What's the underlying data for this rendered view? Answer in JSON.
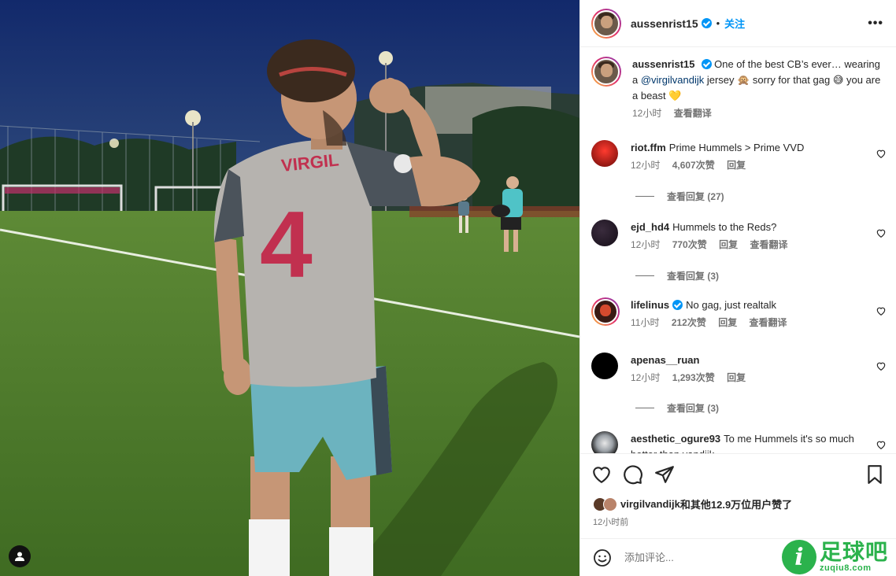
{
  "post": {
    "username": "aussenrist15",
    "follow_label": "关注",
    "dot": "•",
    "more_label": "•••"
  },
  "caption": {
    "username": "aussenrist15",
    "text_part1": "One of the best CB’s ever… wearing a ",
    "mention": "@virgilvandijk",
    "text_part2": " jersey 🙊 sorry for that gag 😅 you are a beast 💛",
    "time": "12小时",
    "translate_label": "查看翻译"
  },
  "comments": [
    {
      "username": "riot.ffm",
      "text": "Prime Hummels > Prime VVD",
      "time": "12小时",
      "likes": "4,607次赞",
      "reply_label": "回复",
      "replies_label": "查看回复 (27)"
    },
    {
      "username": "ejd_hd4",
      "text": "Hummels to the Reds?",
      "time": "12小时",
      "likes": "770次赞",
      "reply_label": "回复",
      "translate_label": "查看翻译",
      "replies_label": "查看回复 (3)"
    },
    {
      "username": "lifelinus",
      "text": "No gag, just realtalk",
      "time": "11小时",
      "likes": "212次赞",
      "reply_label": "回复",
      "translate_label": "查看翻译"
    },
    {
      "username": "apenas__ruan",
      "text": "",
      "time": "12小时",
      "likes": "1,293次赞",
      "reply_label": "回复",
      "replies_label": "查看回复 (3)"
    },
    {
      "username": "aesthetic_ogure93",
      "text": "To me Hummels it's so much better than vandijk"
    }
  ],
  "likes_summary": {
    "liker": "virgilvandijk",
    "rest": "和其他12.9万位用户赞了"
  },
  "post_time": "12小时前",
  "comment_input": {
    "placeholder": "添加评论..."
  },
  "watermark": {
    "logo": "i",
    "title": "足球吧",
    "url": "zuqiu8.com"
  },
  "jersey": {
    "name": "VIRGIL",
    "number": "4"
  },
  "colors": {
    "accent": "#0095f6",
    "link": "#00376b",
    "muted": "#737373",
    "watermark_green": "#2bb24c"
  }
}
